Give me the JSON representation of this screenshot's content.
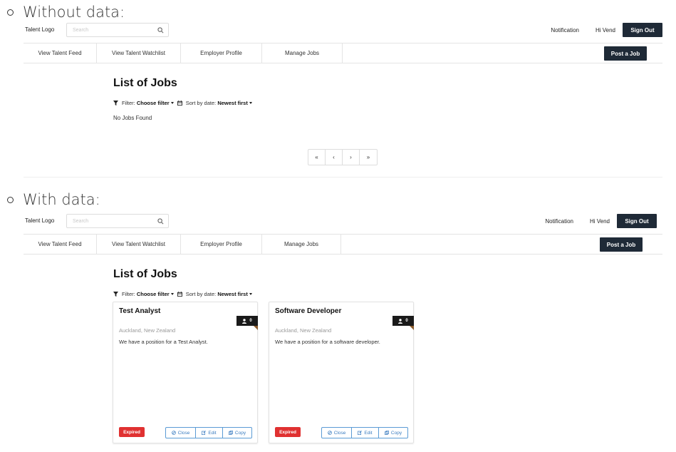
{
  "sections": {
    "without_data_label": "Without data:",
    "with_data_label": "With data:"
  },
  "header": {
    "logo": "Talent Logo",
    "search_placeholder": "Search",
    "notification": "Notification",
    "greeting": "Hi Vend",
    "sign_out": "Sign Out"
  },
  "nav": {
    "items": [
      "View Talent Feed",
      "View Talent Watchlist",
      "Employer Profile",
      "Manage Jobs"
    ],
    "post_job": "Post a Job"
  },
  "jobs_page": {
    "title": "List of Jobs",
    "filter_label": "Filter:",
    "filter_value": "Choose filter",
    "sort_label": "Sort by date:",
    "sort_value": "Newest first",
    "empty_message": "No Jobs Found",
    "pagination": [
      "«",
      "‹",
      "›",
      "»"
    ]
  },
  "jobs": [
    {
      "title": "Test Analyst",
      "applicants": "0",
      "location": "Auckland, New Zealand",
      "description": "We have a position for a Test Analyst.",
      "status": "Expired",
      "actions": [
        "Close",
        "Edit",
        "Copy"
      ]
    },
    {
      "title": "Software Developer",
      "applicants": "0",
      "location": "Auckland, New Zealand",
      "description": "We have a position for a software developer.",
      "status": "Expired",
      "actions": [
        "Close",
        "Edit",
        "Copy"
      ]
    }
  ],
  "colors": {
    "primary_dark": "#1f2a37",
    "expired_red": "#e03131",
    "action_blue": "#3a7cc0"
  }
}
